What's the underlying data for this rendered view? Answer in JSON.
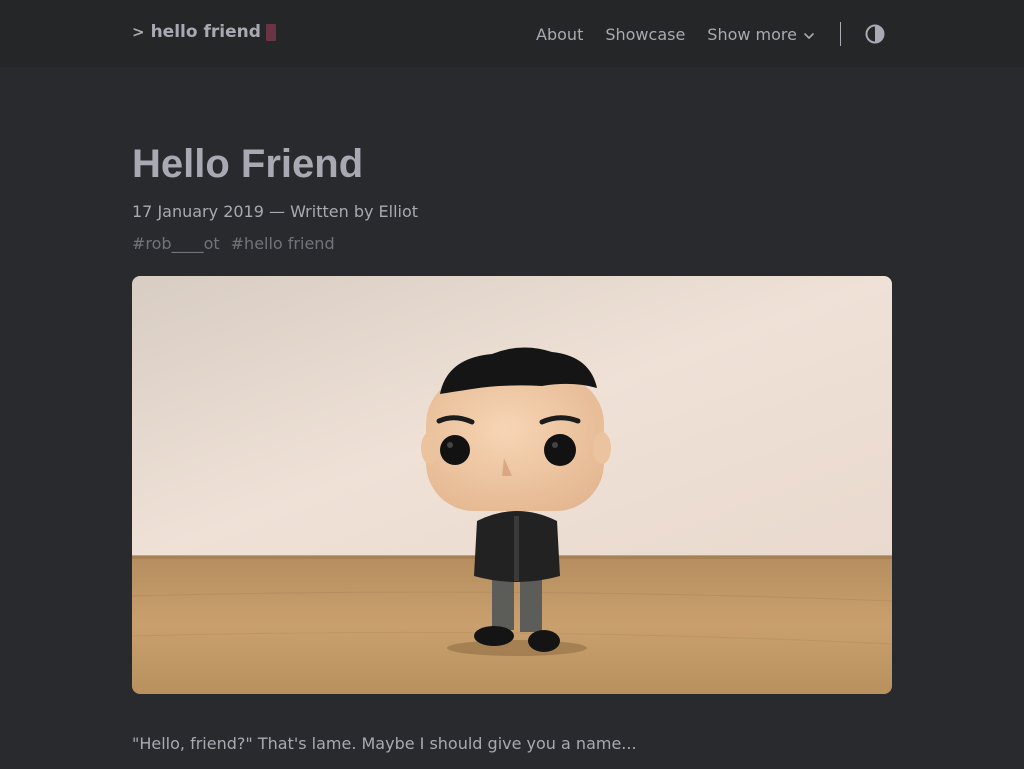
{
  "header": {
    "logo_mark": ">",
    "logo_text": "hello friend",
    "nav": {
      "about": "About",
      "showcase": "Showcase",
      "show_more": "Show more"
    },
    "accent_color": "#6a3444"
  },
  "post": {
    "title": "Hello Friend",
    "meta": "17 January 2019 — Written by Elliot",
    "tags": [
      "#rob____ot",
      "#hello friend"
    ],
    "intro": "\"Hello, friend?\" That's lame. Maybe I should give you a name..."
  },
  "icons": {
    "theme_toggle": "contrast-icon",
    "dropdown": "chevron-down-icon"
  }
}
